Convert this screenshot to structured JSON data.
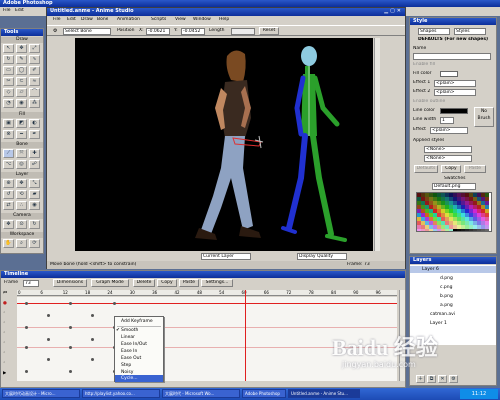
{
  "photoshop": {
    "title": "Adobe Photoshop",
    "menu": [
      "File",
      "Edit"
    ]
  },
  "app": {
    "title": "Untitled.anme - Anime Studio",
    "menu": [
      "File",
      "Edit",
      "Draw",
      "Bone",
      "Animation",
      "Scripts",
      "View",
      "Window",
      "Help"
    ],
    "toolbar": {
      "tool_name": "Select Bone",
      "position_label": "Position",
      "x_label": "X:",
      "x_value": "-0.0621",
      "y_label": "Y:",
      "y_value": "-0.0452",
      "length_label": "Length",
      "reset_label": "Reset"
    }
  },
  "tools": {
    "title": "Tools",
    "sections": {
      "draw": "Draw",
      "fill": "Fill",
      "bone": "Bone",
      "layer": "Layer",
      "camera": "Camera",
      "workspace": "Workspace"
    }
  },
  "canvas": {
    "status": "Move bone (hold <shift> to constrain)",
    "frame_label": "Frame: 73",
    "layer_select": "Current Layer",
    "quality_select": "Display Quality"
  },
  "timeline": {
    "title": "Timeline",
    "frame_label": "Frame",
    "frame_value": "73",
    "dimensions": "Dimensions",
    "graph_mode": "Graph Mode",
    "buttons": [
      "Delete",
      "Copy",
      "Paste",
      "Settings..."
    ],
    "ticks": [
      "0",
      "6",
      "12",
      "18",
      "24",
      "30",
      "36",
      "42",
      "48",
      "54",
      "60",
      "66",
      "72",
      "78",
      "84",
      "90",
      "96"
    ]
  },
  "context_menu": {
    "items": [
      "Add Keyframe",
      "Smooth",
      "Linear",
      "Ease In/Out",
      "Ease In",
      "Ease Out",
      "Step",
      "Noisy",
      "Cycle..."
    ],
    "checked": "Smooth",
    "selected": "Cycle..."
  },
  "style": {
    "title": "Style",
    "shapes_select": "Shapes",
    "styles_select": "Styles",
    "defaults_heading": "DEFAULTS (For new shapes)",
    "name_label": "Name",
    "enable_fill": "Enable fill",
    "fill_color": "Fill color",
    "effect1": "Effect 1",
    "effect2": "Effect 2",
    "plain": "<plain>",
    "enable_outline": "Enable outline",
    "line_color": "Line color",
    "line_width": "Line width",
    "line_width_value": "1",
    "no_brush": "No Brush",
    "effect": "Effect",
    "applied_styles": "Applied styles",
    "none": "<None>",
    "defaults_btn": "Defaults",
    "copy_btn": "Copy",
    "paste_btn": "Paste",
    "swatches_label": "Swatches",
    "swatches_select": "Default.png"
  },
  "layers": {
    "title": "Layers",
    "items": [
      "Layer 6",
      "d.png",
      "c.png",
      "b.png",
      "a.png",
      "catman.avi",
      "Layer 1"
    ],
    "selected": "Layer 6"
  },
  "taskbar": {
    "items": [
      "大展时代动画设计 - Micro...",
      "http://playlist.yahoo.co...",
      "大展时代 - Microsoft Wo...",
      "Adobe Photoshop",
      "Untitled.anme - Anime Stu..."
    ],
    "clock": "11:12",
    "active": "Untitled.anme - Anime Stu..."
  },
  "watermark": {
    "text": "Baidu 经验",
    "url": "jingyan.baidu.com"
  },
  "colors": {
    "title_bar": "#0c2e9a",
    "canvas_bg": "#000000",
    "panel_bg": "#d4d0c8",
    "red_line": "#e02020"
  }
}
